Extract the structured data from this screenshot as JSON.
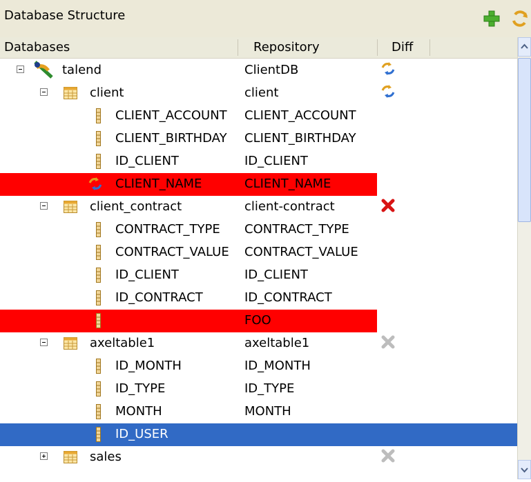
{
  "panel": {
    "title": "Database Structure"
  },
  "toolbar": {
    "add_icon": "plus-icon",
    "refresh_icon": "refresh-icon"
  },
  "columns": {
    "databases": "Databases",
    "repository": "Repository",
    "diff": "Diff"
  },
  "tree": [
    {
      "db": "talend",
      "repo": "ClientDB",
      "level": 0,
      "kind": "database",
      "expander": "minus",
      "diff": "sync",
      "highlight": ""
    },
    {
      "db": "client",
      "repo": "client",
      "level": 1,
      "kind": "table",
      "expander": "minus",
      "diff": "sync",
      "highlight": ""
    },
    {
      "db": "CLIENT_ACCOUNT",
      "repo": "CLIENT_ACCOUNT",
      "level": 2,
      "kind": "column",
      "expander": "",
      "diff": "",
      "highlight": ""
    },
    {
      "db": "CLIENT_BIRTHDAY",
      "repo": "CLIENT_BIRTHDAY",
      "level": 2,
      "kind": "column",
      "expander": "",
      "diff": "",
      "highlight": ""
    },
    {
      "db": "ID_CLIENT",
      "repo": "ID_CLIENT",
      "level": 2,
      "kind": "column",
      "expander": "",
      "diff": "",
      "highlight": ""
    },
    {
      "db": "CLIENT_NAME",
      "repo": "CLIENT_NAME",
      "level": 2,
      "kind": "sync",
      "expander": "",
      "diff": "",
      "highlight": "red"
    },
    {
      "db": "client_contract",
      "repo": "client-contract",
      "level": 1,
      "kind": "table",
      "expander": "minus",
      "diff": "delete-red",
      "highlight": ""
    },
    {
      "db": "CONTRACT_TYPE",
      "repo": "CONTRACT_TYPE",
      "level": 2,
      "kind": "column",
      "expander": "",
      "diff": "",
      "highlight": ""
    },
    {
      "db": "CONTRACT_VALUE",
      "repo": "CONTRACT_VALUE",
      "level": 2,
      "kind": "column",
      "expander": "",
      "diff": "",
      "highlight": ""
    },
    {
      "db": "ID_CLIENT",
      "repo": "ID_CLIENT",
      "level": 2,
      "kind": "column",
      "expander": "",
      "diff": "",
      "highlight": ""
    },
    {
      "db": "ID_CONTRACT",
      "repo": "ID_CONTRACT",
      "level": 2,
      "kind": "column",
      "expander": "",
      "diff": "",
      "highlight": ""
    },
    {
      "db": "",
      "repo": "FOO",
      "level": 2,
      "kind": "column",
      "expander": "",
      "diff": "",
      "highlight": "red"
    },
    {
      "db": "axeltable1",
      "repo": "axeltable1",
      "level": 1,
      "kind": "table",
      "expander": "minus",
      "diff": "delete-gray",
      "highlight": ""
    },
    {
      "db": "ID_MONTH",
      "repo": "ID_MONTH",
      "level": 2,
      "kind": "column",
      "expander": "",
      "diff": "",
      "highlight": ""
    },
    {
      "db": "ID_TYPE",
      "repo": "ID_TYPE",
      "level": 2,
      "kind": "column",
      "expander": "",
      "diff": "",
      "highlight": ""
    },
    {
      "db": "MONTH",
      "repo": "MONTH",
      "level": 2,
      "kind": "column",
      "expander": "",
      "diff": "",
      "highlight": ""
    },
    {
      "db": "ID_USER",
      "repo": "",
      "level": 2,
      "kind": "column",
      "expander": "",
      "diff": "",
      "highlight": "blue"
    },
    {
      "db": "sales",
      "repo": "",
      "level": 1,
      "kind": "table",
      "expander": "plus",
      "diff": "delete-gray",
      "highlight": ""
    }
  ]
}
